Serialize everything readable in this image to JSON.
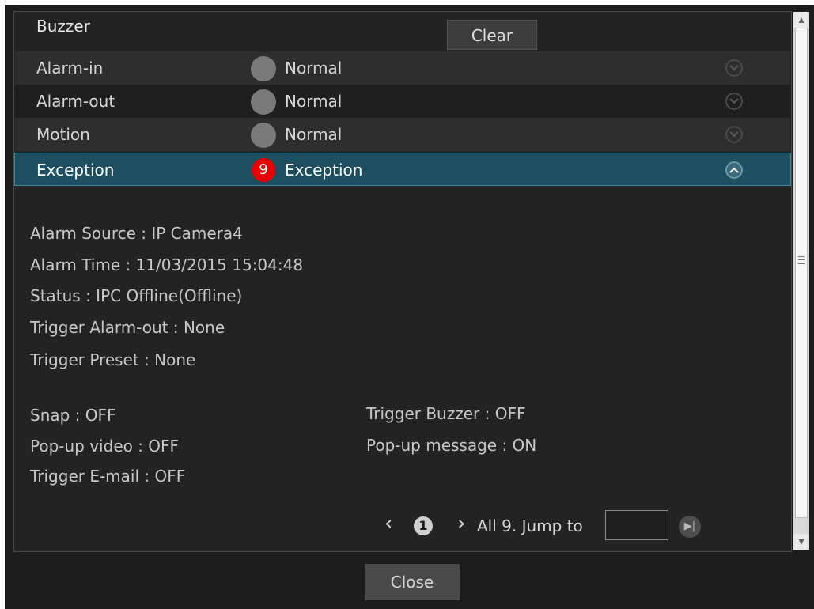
{
  "header": {
    "buzzer_label": "Buzzer",
    "clear_label": "Clear"
  },
  "rows": [
    {
      "label": "Alarm-in",
      "state": "Normal"
    },
    {
      "label": "Alarm-out",
      "state": "Normal"
    },
    {
      "label": "Motion",
      "state": "Normal"
    },
    {
      "label": "Exception",
      "state": "Exception",
      "count": "9"
    }
  ],
  "details": {
    "alarm_source": "Alarm Source : IP Camera4",
    "alarm_time": "Alarm Time : 11/03/2015 15:04:48",
    "status": "Status : IPC Offline(Offline)",
    "trigger_alarm_out": "Trigger Alarm-out : None",
    "trigger_preset": "Trigger Preset : None",
    "snap": "Snap : OFF",
    "popup_video": "Pop-up video : OFF",
    "trigger_email": "Trigger E-mail : OFF",
    "trigger_buzzer": "Trigger Buzzer : OFF",
    "popup_message": "Pop-up message : ON"
  },
  "pager": {
    "current_page": "1",
    "summary": "All 9. Jump to",
    "jump_value": ""
  },
  "footer": {
    "close_label": "Close"
  },
  "icons": {
    "expand": "chevron-down-icon",
    "collapse": "chevron-up-icon",
    "prev": "chevron-left-icon",
    "next": "chevron-right-icon",
    "last": "skip-to-last-icon"
  },
  "colors": {
    "accent_row": "#1d4f61",
    "alarm_badge": "#e60000"
  }
}
